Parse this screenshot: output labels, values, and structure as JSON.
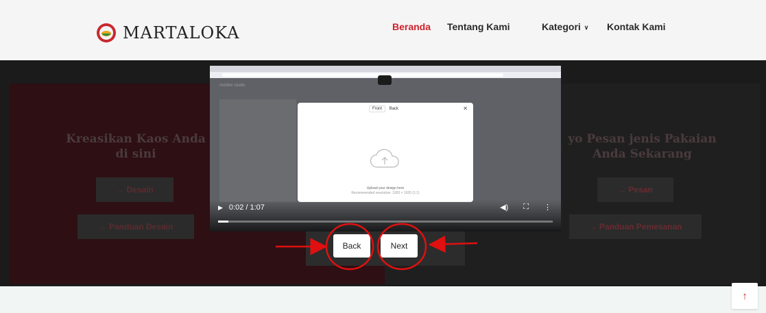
{
  "brand": {
    "name": "MARTALOKA"
  },
  "nav": {
    "items": [
      {
        "label": "Beranda",
        "active": true
      },
      {
        "label": "Tentang Kami",
        "active": false
      },
      {
        "label": "Kategori",
        "active": false,
        "has_dropdown": true
      },
      {
        "label": "Kontak Kami",
        "active": false
      }
    ]
  },
  "hero": {
    "left": {
      "title": "Kreasikan Kaos Anda di sini",
      "buttons": [
        "→ Desain",
        "→ Panduan Desain"
      ]
    },
    "right": {
      "title": "yo Pesan jenis Pakaian Anda Sekarang",
      "buttons": [
        "→ Pesan",
        "→ Panduan Pemesanan"
      ]
    }
  },
  "video": {
    "time": "0:02 / 1:07",
    "progress": 0.03,
    "embedded_app": {
      "brand": "mortlex studio",
      "modal_tabs": [
        "Front",
        "Back"
      ],
      "upload_title": "Upload your design here",
      "upload_hint": "Recommended resolution: 1920 × 1920 (1:1)"
    }
  },
  "controls": {
    "back_label": "Back",
    "next_label": "Next"
  },
  "back_to_top_icon": "arrow-up-icon",
  "colors": {
    "accent": "#d0202b",
    "annotation": "#e01010"
  }
}
